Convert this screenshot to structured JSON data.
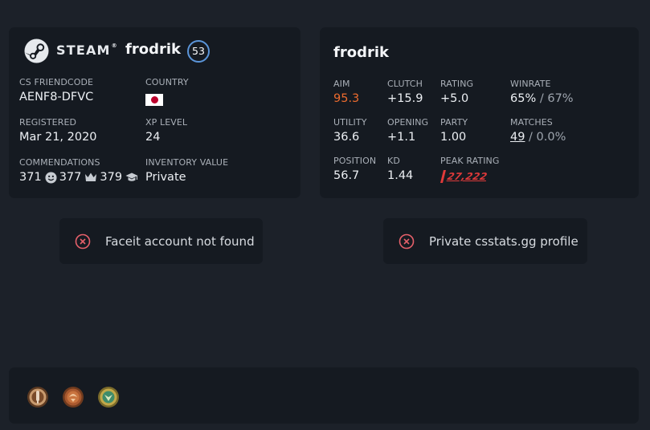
{
  "steam": {
    "brand": "STEAM",
    "brand_reg": "®",
    "username": "frodrik",
    "level": "53",
    "friendcode_label": "CS FRIENDCODE",
    "friendcode": "AENF8-DFVC",
    "country_label": "COUNTRY",
    "country_flag_icon": "japan-flag-icon",
    "registered_label": "REGISTERED",
    "registered": "Mar 21, 2020",
    "xp_label": "XP LEVEL",
    "xp": "24",
    "commendations_label": "COMMENDATIONS",
    "commendations": [
      {
        "count": "371",
        "icon": "smiley-icon"
      },
      {
        "count": "377",
        "icon": "crown-icon"
      },
      {
        "count": "379",
        "icon": "graduation-cap-icon"
      }
    ],
    "inventory_label": "INVENTORY VALUE",
    "inventory": "Private"
  },
  "csstats": {
    "username": "frodrik",
    "stats": {
      "aim": {
        "label": "AIM",
        "value": "95.3"
      },
      "clutch": {
        "label": "CLUTCH",
        "value": "+15.9"
      },
      "rating": {
        "label": "RATING",
        "value": "+5.0"
      },
      "winrate": {
        "label": "WINRATE",
        "value": "65%",
        "secondary": " / 67%"
      },
      "utility": {
        "label": "UTILITY",
        "value": "36.6"
      },
      "opening": {
        "label": "OPENING",
        "value": "+1.1"
      },
      "party": {
        "label": "PARTY",
        "value": "1.00"
      },
      "matches": {
        "label": "MATCHES",
        "value": "49",
        "secondary": " / 0.0%"
      },
      "position": {
        "label": "POSITION",
        "value": "56.7"
      },
      "kd": {
        "label": "KD",
        "value": "1.44"
      },
      "peak_rating": {
        "label": "PEAK RATING",
        "value": "27,222"
      }
    }
  },
  "notices": {
    "faceit": "Faceit account not found",
    "csstats": "Private csstats.gg profile"
  },
  "badges": [
    "service-medal-icon",
    "operation-coin-icon",
    "pin-coin-icon"
  ],
  "colors": {
    "background": "#1c2129",
    "card": "#151a21",
    "aim_accent": "#ec6b2e",
    "peak_rating": "#e03a3a",
    "level_ring": "#5b95d9",
    "error_icon": "#e5606a"
  }
}
